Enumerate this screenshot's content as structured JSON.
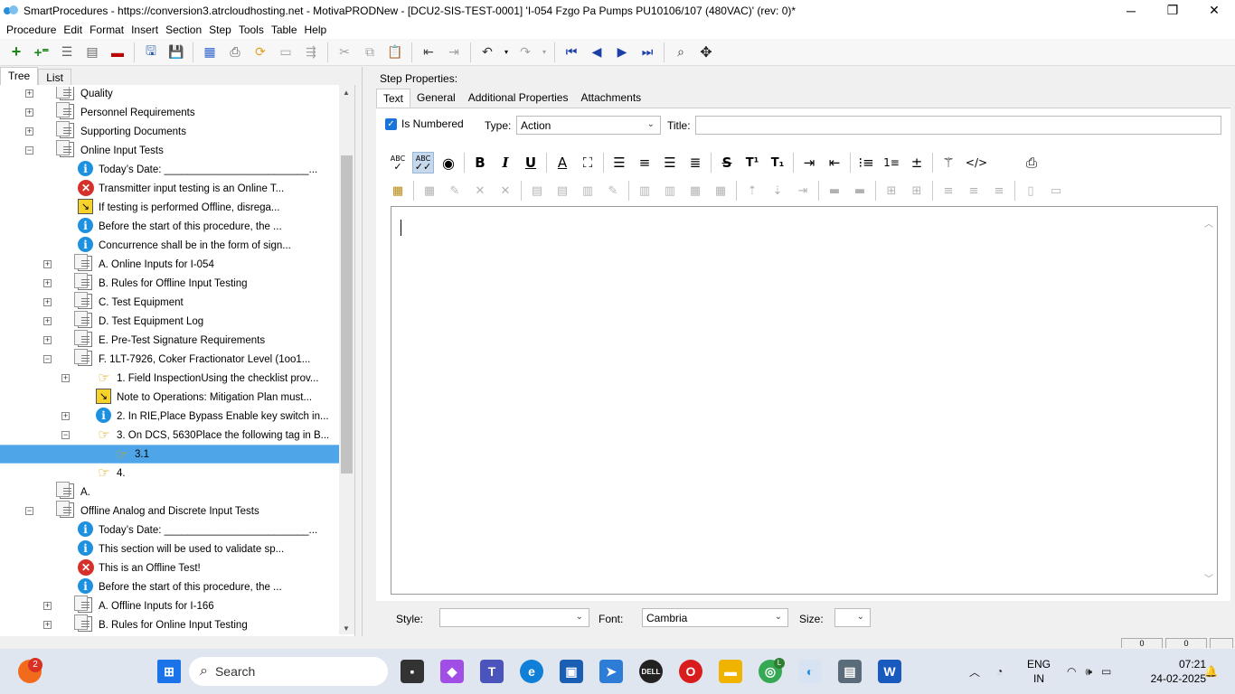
{
  "window": {
    "title": "SmartProcedures - https://conversion3.atrcloudhosting.net - MotivaPRODNew - [DCU2-SIS-TEST-0001] 'I-054 Fzgo Pa Pumps PU10106/107 (480VAC)' (rev: 0)*",
    "minimize": "─",
    "maximize": "❐",
    "close": "✕"
  },
  "menu": [
    "Procedure",
    "Edit",
    "Format",
    "Insert",
    "Section",
    "Step",
    "Tools",
    "Table",
    "Help"
  ],
  "left_tabs": [
    "Tree",
    "List"
  ],
  "tree": [
    {
      "label": "Quality",
      "icon": "doc",
      "exp": "+",
      "indent": 0
    },
    {
      "label": "Personnel Requirements",
      "icon": "doc",
      "exp": "+",
      "indent": 0
    },
    {
      "label": "Supporting Documents",
      "icon": "doc",
      "exp": "+",
      "indent": 0
    },
    {
      "label": "Online Input Tests",
      "icon": "doc",
      "exp": "−",
      "indent": 0
    },
    {
      "label": "Today’s Date: _________________________...",
      "icon": "info",
      "exp": "",
      "indent": 1
    },
    {
      "label": "Transmitter input testing is an Online T...",
      "icon": "err",
      "exp": "",
      "indent": 1
    },
    {
      "label": "If testing is performed Offline, disrega...",
      "icon": "note",
      "exp": "",
      "indent": 1
    },
    {
      "label": "Before the start of this procedure, the ...",
      "icon": "info",
      "exp": "",
      "indent": 1
    },
    {
      "label": "Concurrence shall be in the form of sign...",
      "icon": "info",
      "exp": "",
      "indent": 1
    },
    {
      "label": "A. Online Inputs for I-054",
      "icon": "doc",
      "exp": "+",
      "indent": 1
    },
    {
      "label": "B. Rules for Offline Input Testing",
      "icon": "doc",
      "exp": "+",
      "indent": 1
    },
    {
      "label": "C. Test Equipment",
      "icon": "doc",
      "exp": "+",
      "indent": 1
    },
    {
      "label": "D. Test Equipment Log",
      "icon": "doc",
      "exp": "+",
      "indent": 1
    },
    {
      "label": "E. Pre-Test Signature Requirements",
      "icon": "doc",
      "exp": "+",
      "indent": 1
    },
    {
      "label": "F. 1LT-7926, Coker Fractionator Level (1oo1...",
      "icon": "doc",
      "exp": "−",
      "indent": 1
    },
    {
      "label": "1. Field InspectionUsing the checklist prov...",
      "icon": "hand",
      "exp": "+",
      "indent": 2
    },
    {
      "label": "Note to Operations: Mitigation Plan must...",
      "icon": "note",
      "exp": "",
      "indent": 2
    },
    {
      "label": "2. In RIE,Place Bypass Enable key switch in...",
      "icon": "info",
      "exp": "+",
      "indent": 2
    },
    {
      "label": "3. On DCS, 5630Place the following tag in B...",
      "icon": "hand",
      "exp": "−",
      "indent": 2
    },
    {
      "label": "3.1",
      "icon": "hand",
      "exp": "",
      "indent": 3,
      "selected": true
    },
    {
      "label": "4.",
      "icon": "hand",
      "exp": "",
      "indent": 2
    },
    {
      "label": "A.",
      "icon": "doc",
      "exp": "",
      "indent": 0
    },
    {
      "label": "Offline Analog and Discrete Input Tests",
      "icon": "doc",
      "exp": "−",
      "indent": 0
    },
    {
      "label": "Today’s Date: _________________________...",
      "icon": "info",
      "exp": "",
      "indent": 1
    },
    {
      "label": "This section will be used to validate sp...",
      "icon": "info",
      "exp": "",
      "indent": 1
    },
    {
      "label": "This is an Offline Test!",
      "icon": "err",
      "exp": "",
      "indent": 1
    },
    {
      "label": "Before the start of this procedure, the ...",
      "icon": "info",
      "exp": "",
      "indent": 1
    },
    {
      "label": "A. Offline Inputs for I-166",
      "icon": "doc",
      "exp": "+",
      "indent": 1
    },
    {
      "label": "B. Rules for Online Input Testing",
      "icon": "doc",
      "exp": "+",
      "indent": 1
    }
  ],
  "step_properties": {
    "heading": "Step Properties:",
    "tabs": [
      "Text",
      "General",
      "Additional Properties",
      "Attachments"
    ],
    "is_numbered_label": "Is Numbered",
    "is_numbered_checked": true,
    "type_label": "Type:",
    "type_value": "Action",
    "title_label": "Title:",
    "title_value": "",
    "style_label": "Style:",
    "style_value": "",
    "font_label": "Font:",
    "font_value": "Cambria",
    "size_label": "Size:",
    "size_value": ""
  },
  "format_buttons": {
    "spell_check": "ABC",
    "spell_check_all": "ABC",
    "bold": "B",
    "italic": "I",
    "underline": "U",
    "strike": "S",
    "superscript": "T¹",
    "subscript": "T₁",
    "html": "</>"
  },
  "taskbar": {
    "search_placeholder": "Search",
    "notification_count": "2",
    "chrome_badge": "L",
    "lang_line1": "ENG",
    "lang_line2": "IN",
    "time": "07:21",
    "date": "24-02-2025"
  },
  "status_cells": [
    "0",
    "0"
  ],
  "colors": {
    "selection": "#4ea6e8",
    "info_icon": "#1e90e0",
    "error_icon": "#d6302a",
    "note_icon": "#f7d22b"
  }
}
